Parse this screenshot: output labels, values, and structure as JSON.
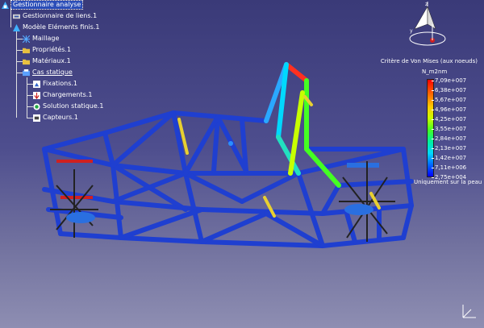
{
  "tree": {
    "root": "Gestionnaire analyse",
    "items": [
      {
        "label": "Gestionnaire de liens.1"
      },
      {
        "label": "Modèle Eléments finis.1"
      },
      {
        "label": "Maillage"
      },
      {
        "label": "Propriétés.1"
      },
      {
        "label": "Matériaux.1"
      },
      {
        "label": "Cas statique"
      },
      {
        "label": "Fixations.1"
      },
      {
        "label": "Chargements.1"
      },
      {
        "label": "Solution statique.1"
      },
      {
        "label": "Capteurs.1"
      }
    ]
  },
  "legend": {
    "title": "Critère de Von Mises (aux noeuds)",
    "unit": "N_m2nm",
    "values": [
      "7,09e+007",
      "6,38e+007",
      "5,67e+007",
      "4,96e+007",
      "4,25e+007",
      "3,55e+007",
      "2,84e+007",
      "2,13e+007",
      "1,42e+007",
      "7,11e+006",
      "2,75e+004"
    ],
    "note": "Uniquement sur la peau",
    "colors": [
      "#ff0000",
      "#ffcc00",
      "#44ff22",
      "#00d8ff",
      "#0000ff"
    ]
  },
  "compass": {
    "z": "z",
    "y": "y"
  },
  "colors": {
    "frame": "#1f3fd0",
    "frame_dark": "#10238a",
    "tree_selected": "#2a4db8"
  }
}
